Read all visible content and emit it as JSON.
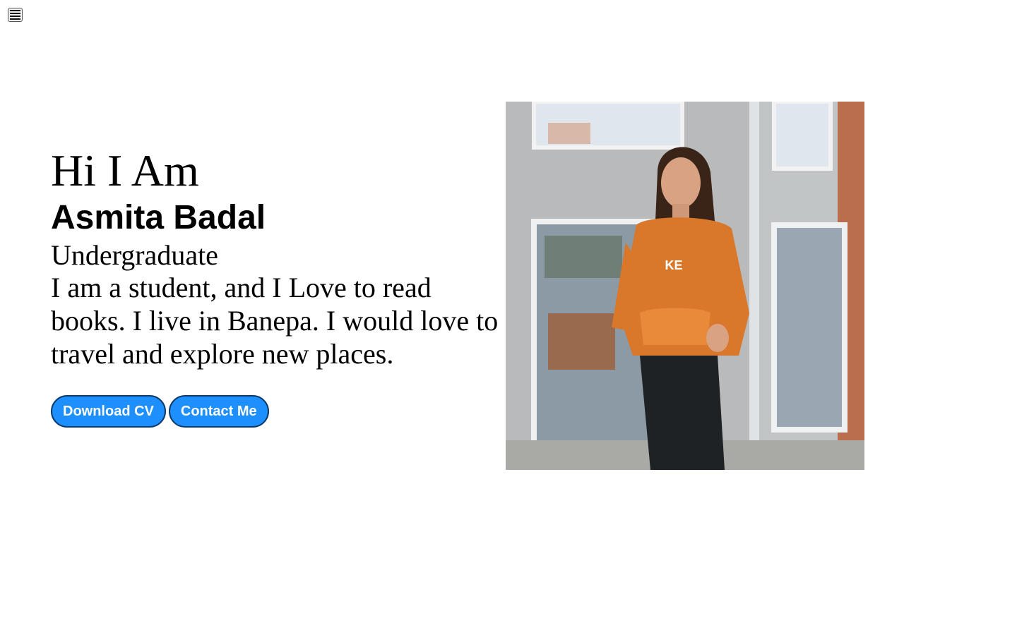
{
  "nav": {
    "menu_icon": "hamburger-menu-icon"
  },
  "hero": {
    "greeting": "Hi I Am",
    "name": "Asmita Badal",
    "role": "Undergraduate",
    "bio": "I am a student, and I Love to read books. I live in Banepa. I would love to travel and explore new places.",
    "buttons": {
      "download_cv": "Download CV",
      "contact_me": "Contact Me"
    },
    "profile_photo_text": "KE",
    "accent_color": "#1e8fff"
  }
}
